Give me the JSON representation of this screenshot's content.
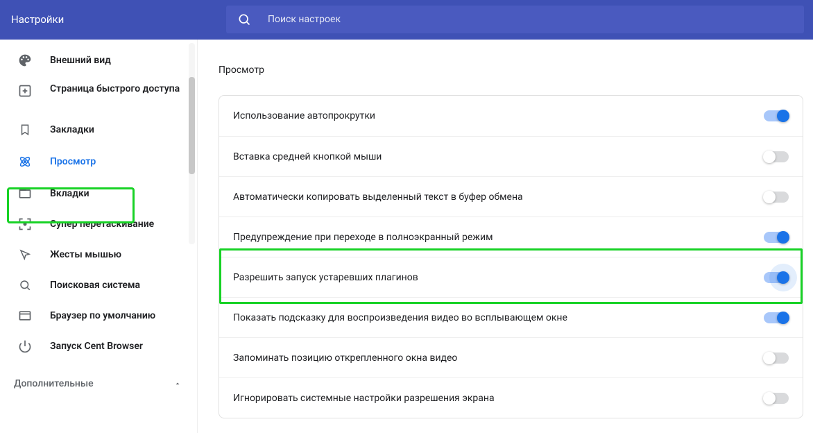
{
  "header": {
    "title": "Настройки",
    "search_placeholder": "Поиск настроек"
  },
  "sidebar": {
    "items": [
      {
        "label": "Внешний вид"
      },
      {
        "label": "Страница быстрого доступа"
      },
      {
        "label": "Закладки"
      },
      {
        "label": "Просмотр"
      },
      {
        "label": "Вкладки"
      },
      {
        "label": "Супер перетаскивание"
      },
      {
        "label": "Жесты мышью"
      },
      {
        "label": "Поисковая система"
      },
      {
        "label": "Браузер по умолчанию"
      },
      {
        "label": "Запуск Cent Browser"
      }
    ],
    "advanced_label": "Дополнительные"
  },
  "content": {
    "section_title": "Просмотр",
    "rows": [
      {
        "label": "Использование автопрокрутки",
        "on": true
      },
      {
        "label": "Вставка средней кнопкой мыши",
        "on": false
      },
      {
        "label": "Автоматически копировать выделенный текст в буфер обмена",
        "on": false
      },
      {
        "label": "Предупреждение при переходе в полноэкранный режим",
        "on": true
      },
      {
        "label": "Разрешить запуск устаревших плагинов",
        "on": true
      },
      {
        "label": "Показать подсказку для воспроизведения видео во всплывающем окне",
        "on": true
      },
      {
        "label": "Запоминать позицию открепленного окна видео",
        "on": false
      },
      {
        "label": "Игнорировать системные настройки разрешения экрана",
        "on": false
      }
    ]
  }
}
